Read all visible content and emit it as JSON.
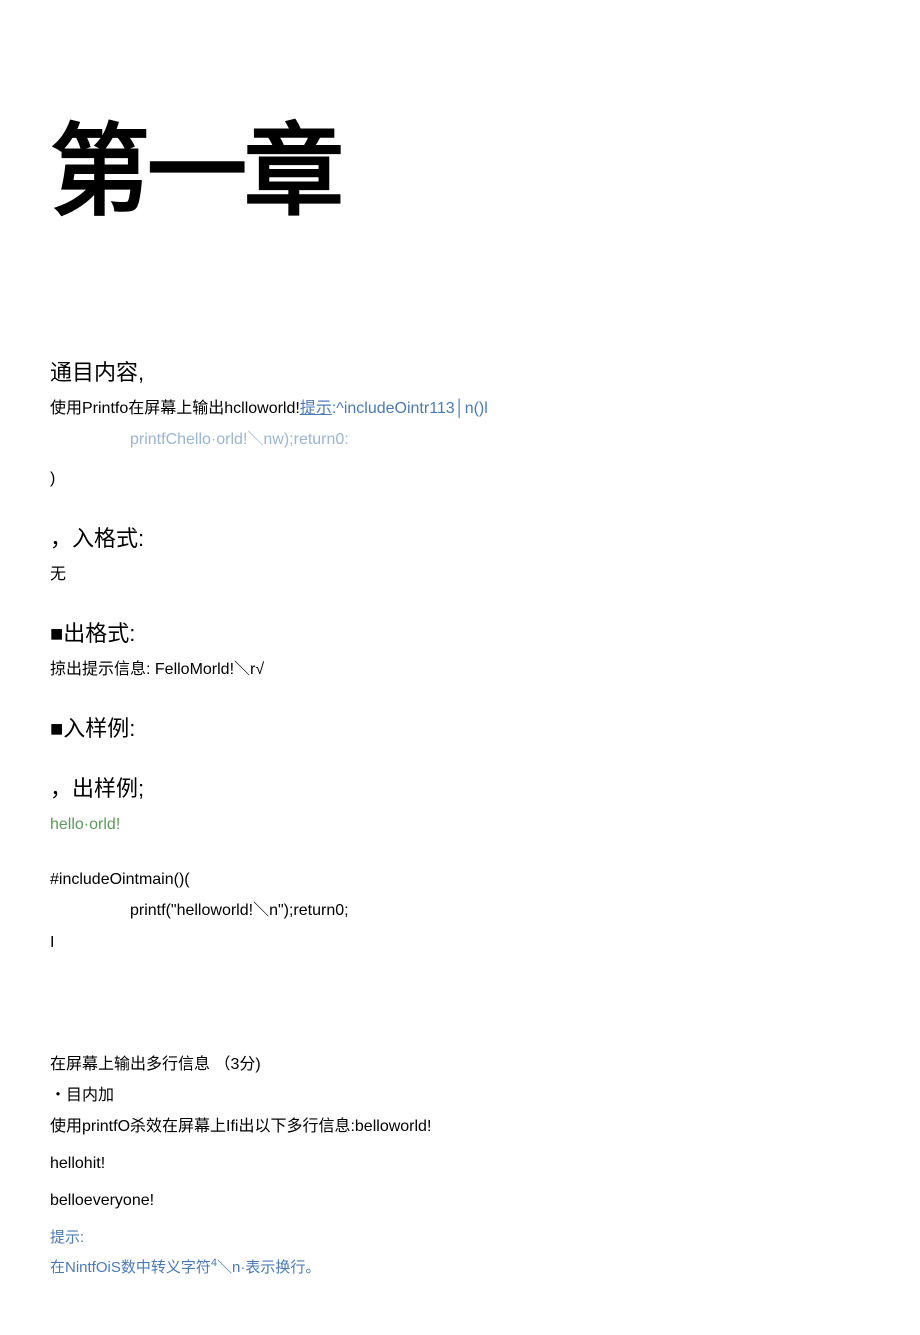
{
  "chapter_title": "第一章",
  "section1": {
    "heading": "通目内容,",
    "line1_a": "使用Printfo在屏幕上输出hclloworld!",
    "line1_link": "提示",
    "line1_b": ":^includeOintr113│n()l",
    "line2": "printfChello·orld!＼nw);return0:",
    "line3": ")"
  },
  "input_format": {
    "heading": "，入格式:",
    "content": "无"
  },
  "output_format": {
    "heading": "■出格式:",
    "content": "掠出提示信息: FelloMorld!＼r√"
  },
  "input_example": {
    "heading": "■入样例:"
  },
  "output_example": {
    "heading": "，出样例;",
    "content": "hello·orld!"
  },
  "code1": {
    "line1": "#includeOintmain()(",
    "line2": "printf(\"helloworld!＼n\");return0;",
    "line3": "I"
  },
  "section2": {
    "line1": "在屏幕上输出多行信息 （3分)",
    "line2": "・目内加",
    "line3": "使用printfO杀效在屏幕上Ifi出以下多行信息:belloworld!",
    "line4": "hellohit!",
    "line5": "belloeveryone!",
    "hint_label": "提示:",
    "hint_content_a": "在NintfOiS数中转义字符",
    "hint_super": "4",
    "hint_content_b": "＼n·表示换行。"
  }
}
